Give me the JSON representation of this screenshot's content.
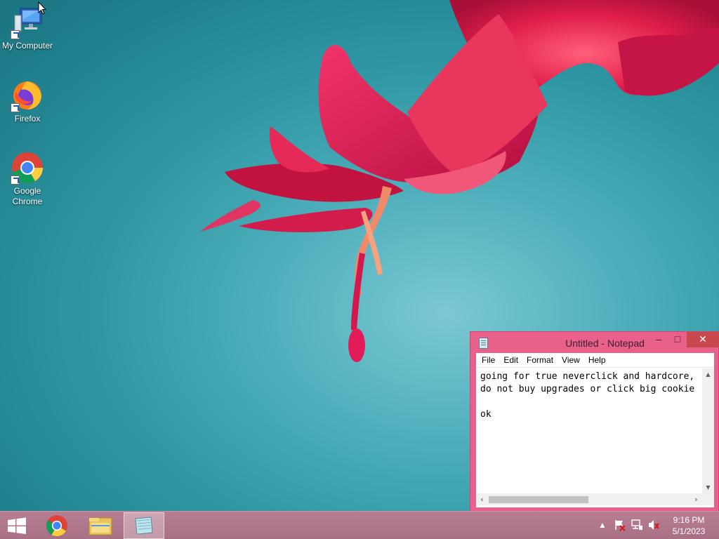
{
  "desktop": {
    "icons": [
      {
        "label": "My Computer"
      },
      {
        "label": "Firefox"
      },
      {
        "label": "Google\nChrome"
      }
    ]
  },
  "notepad": {
    "title": "Untitled - Notepad",
    "menu": [
      "File",
      "Edit",
      "Format",
      "View",
      "Help"
    ],
    "text": "going for true neverclick and hardcore,\ndo not buy upgrades or click big cookie\n\nok"
  },
  "taskbar": {
    "pinned": [
      {
        "icon": "windows-start-icon"
      },
      {
        "icon": "chrome-icon"
      },
      {
        "icon": "file-explorer-icon"
      },
      {
        "icon": "notepad-icon",
        "active": true
      }
    ],
    "tray_icons": [
      "show-hidden-icons-chevron",
      "action-center-flag-icon",
      "network-icon",
      "volume-muted-icon"
    ],
    "time": "9:16 PM",
    "date": "5/1/2023"
  },
  "colors": {
    "window_frame": "#e9608a",
    "close_button": "#c8484e",
    "taskbar": "#b07489",
    "desktop_bg": "#2f98a4"
  }
}
